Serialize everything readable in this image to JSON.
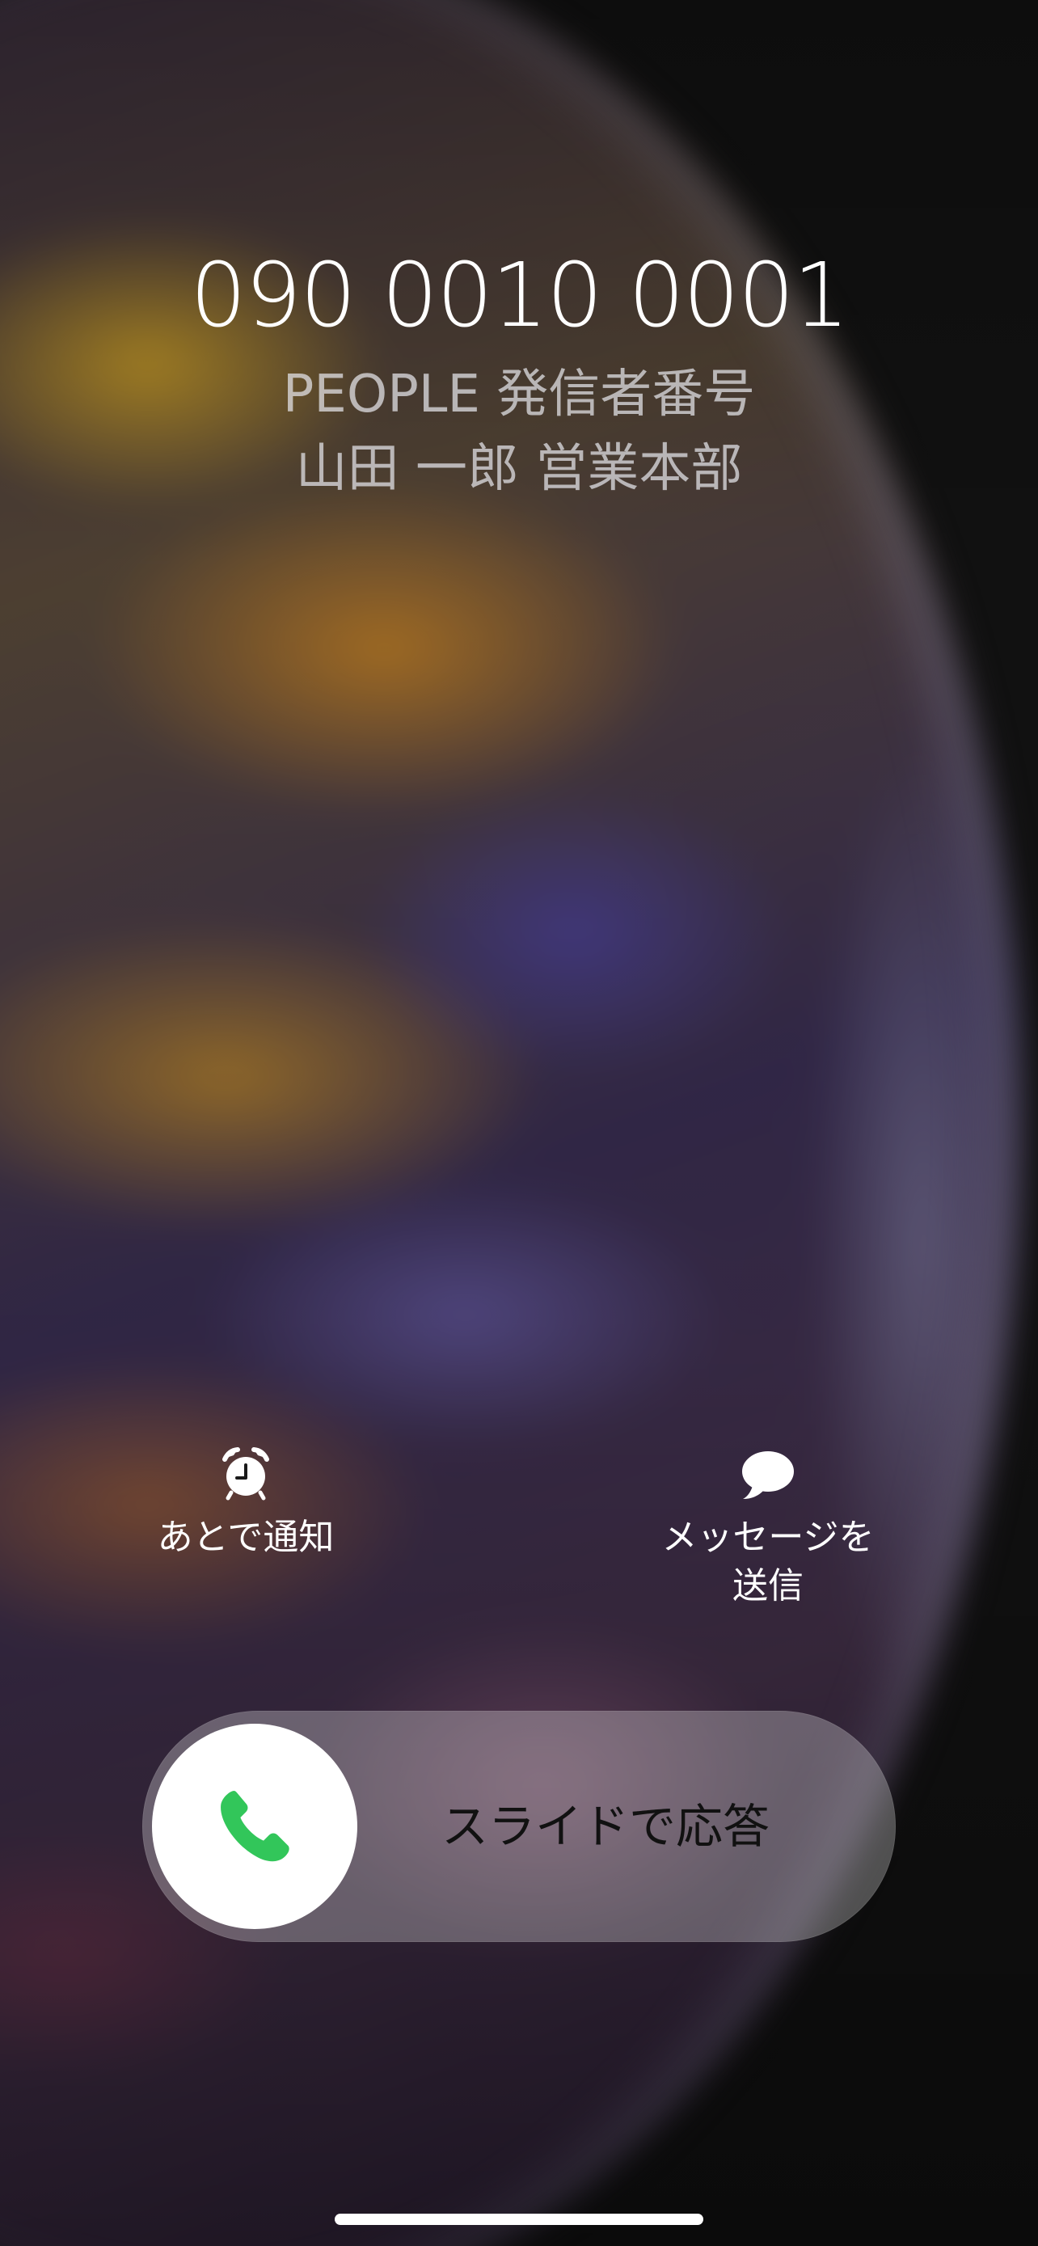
{
  "caller": {
    "number": "090 0010 0001",
    "caller_id_line": "PEOPLE 発信者番号",
    "name_line": "山田 一郎 営業本部"
  },
  "actions": {
    "remind": {
      "icon": "alarm-clock-icon",
      "label": "あとで通知"
    },
    "message": {
      "icon": "speech-bubble-icon",
      "label": "メッセージを\n送信"
    }
  },
  "slider": {
    "icon": "phone-icon",
    "label": "スライドで応答",
    "accent_color": "#32C65A"
  }
}
